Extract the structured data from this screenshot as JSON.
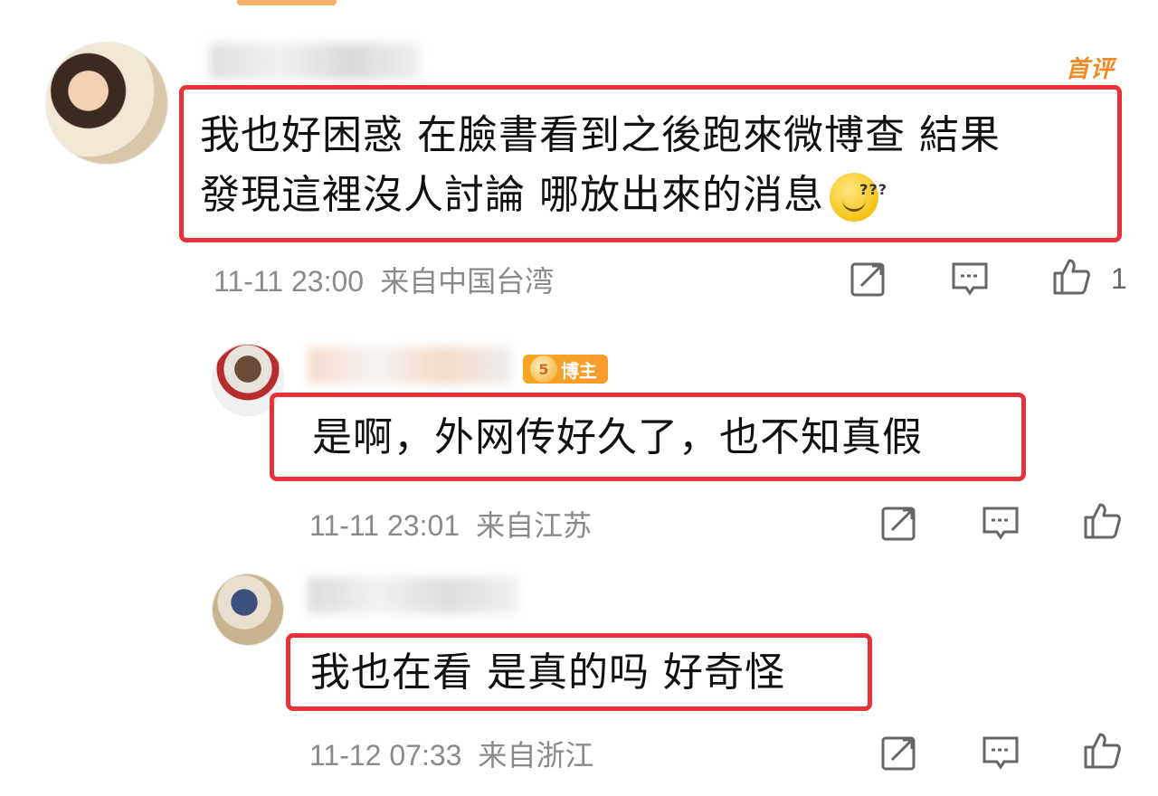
{
  "colors": {
    "highlight_border": "#e8323a",
    "meta_text": "#8a8a8a",
    "badge_orange": "#f6a623"
  },
  "comments": [
    {
      "first_badge": "首评",
      "text_line1": "我也好困惑 在臉書看到之後跑來微博查 結果",
      "text_line2": "發現這裡沒人討論 哪放出來的消息",
      "emoji": "confused-grin-emoji",
      "emoji_marks": "???",
      "time": "11-11 23:00",
      "source": "来自中国台湾",
      "like_count": "1"
    },
    {
      "badge_icon": "5",
      "badge_label": "博主",
      "text": "是啊，外网传好久了，也不知真假",
      "time": "11-11 23:01",
      "source": "来自江苏"
    },
    {
      "text": "我也在看 是真的吗 好奇怪",
      "time": "11-12 07:33",
      "source": "来自浙江"
    }
  ],
  "icons": {
    "share": "share-icon",
    "reply": "comment-icon",
    "like": "thumbs-up-icon"
  }
}
